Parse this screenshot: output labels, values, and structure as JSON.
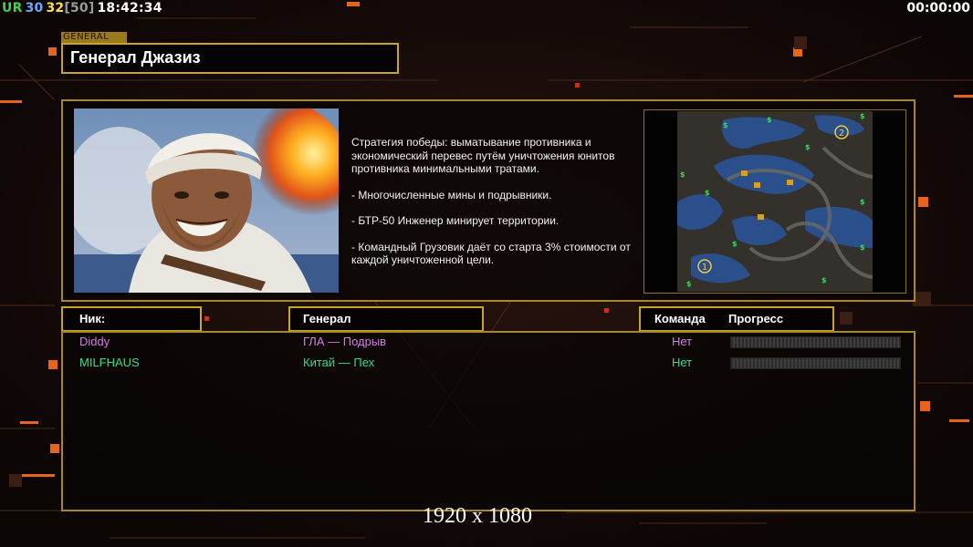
{
  "hud": {
    "prefix": "UR",
    "num_a": "30",
    "num_b": "32",
    "num_c": "[50]",
    "clock": "18:42:34",
    "timer": "00:00:00"
  },
  "colors": {
    "ur": "#3fd24a",
    "num_a": "#6aa8ff",
    "num_b": "#ffe040",
    "num_c": "#9a9a9a",
    "frame": "#c9a522",
    "player1": "#d57be8",
    "player2": "#2fe08a"
  },
  "general": {
    "tag": "GENERAL",
    "name": "Генерал Джазиз"
  },
  "description": {
    "strategy": "Стратегия победы: выматывание противника и экономический перевес путём уничтожения юнитов противника минимальными тратами.",
    "points": [
      "- Многочисленные мины и подрывники.",
      "- БТР-50 Инженер минирует территории.",
      "- Командный Грузовик даёт со старта 3% стоимости от каждой уничтоженной цели."
    ]
  },
  "minimap": {
    "start_1": "1",
    "start_2": "2"
  },
  "table": {
    "headers": {
      "nick": "Ник:",
      "general": "Генерал",
      "team": "Команда",
      "progress": "Прогресс"
    },
    "rows": [
      {
        "nick": "Diddy",
        "general": "ГЛА — Подрыв",
        "team": "Нет",
        "progress": 0
      },
      {
        "nick": "MILFHAUS",
        "general": "Китай — Пех",
        "team": "Нет",
        "progress": 0
      }
    ]
  },
  "resolution": "1920 x 1080"
}
